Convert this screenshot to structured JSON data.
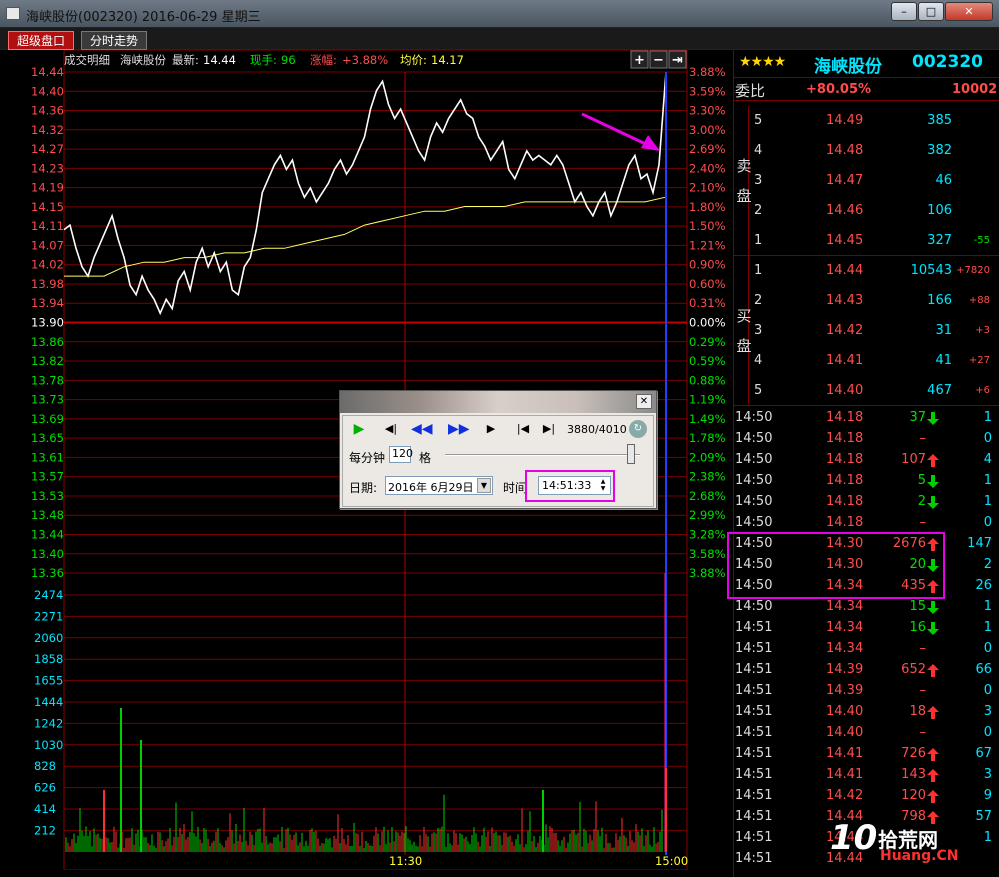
{
  "window": {
    "title": "海峡股份(002320) 2016-06-29 星期三",
    "buttons": [
      "–",
      "□",
      "✕"
    ]
  },
  "tabs": [
    {
      "label": "超级盘口",
      "active": true
    },
    {
      "label": "分时走势",
      "active": false
    }
  ],
  "chart_header": {
    "section": "成交明细",
    "name": "海峡股份",
    "latest_label": "最新:",
    "latest_value": "14.44",
    "hand_label": "现手:",
    "hand_value": "96",
    "change_label": "涨幅:",
    "change_value": "+3.88%",
    "avg_label": "均价:",
    "avg_value": "14.17",
    "tool_buttons": [
      "+",
      "−",
      "⇥"
    ]
  },
  "chart_data": {
    "type": "line",
    "title": "",
    "xlabel": "",
    "ylabel": "",
    "price_ticks": [
      "14.44",
      "14.40",
      "14.36",
      "14.32",
      "14.27",
      "14.23",
      "14.19",
      "14.15",
      "14.11",
      "14.07",
      "14.02",
      "13.98",
      "13.94",
      "13.90",
      "13.86",
      "13.82",
      "13.78",
      "13.73",
      "13.69",
      "13.65",
      "13.61",
      "13.57",
      "13.53",
      "13.48",
      "13.44",
      "13.40",
      "13.36"
    ],
    "pct_ticks": [
      "3.88%",
      "3.59%",
      "3.30%",
      "3.00%",
      "2.69%",
      "2.40%",
      "2.10%",
      "1.80%",
      "1.50%",
      "1.21%",
      "0.90%",
      "0.60%",
      "0.31%",
      "0.00%",
      "0.29%",
      "0.59%",
      "0.88%",
      "1.19%",
      "1.49%",
      "1.78%",
      "2.09%",
      "2.38%",
      "2.68%",
      "2.99%",
      "3.28%",
      "3.58%",
      "3.88%"
    ],
    "volume_ticks": [
      "2474",
      "2271",
      "2060",
      "1858",
      "1655",
      "1444",
      "1242",
      "1030",
      "828",
      "626",
      "414",
      "212"
    ],
    "x_ticks": [
      "11:30",
      "15:00"
    ],
    "prev_close": 13.9,
    "ylim": [
      13.36,
      14.44
    ],
    "series": [
      {
        "color": "#ffffff",
        "values": [
          14.1,
          14.11,
          14.06,
          14.02,
          14.0,
          14.04,
          14.07,
          14.1,
          14.13,
          14.08,
          14.04,
          13.98,
          13.96,
          14.0,
          13.97,
          13.95,
          13.92,
          13.95,
          13.93,
          13.99,
          14.01,
          13.97,
          14.03,
          14.06,
          14.02,
          14.05,
          14.01,
          14.03,
          13.97,
          13.96,
          14.02,
          14.04,
          14.1,
          14.18,
          14.21,
          14.24,
          14.26,
          14.23,
          14.25,
          14.2,
          14.17,
          14.19,
          14.16,
          14.18,
          14.2,
          14.23,
          14.25,
          14.22,
          14.24,
          14.27,
          14.3,
          14.36,
          14.4,
          14.42,
          14.37,
          14.34,
          14.36,
          14.33,
          14.3,
          14.27,
          14.25,
          14.3,
          14.33,
          14.31,
          14.34,
          14.36,
          14.38,
          14.35,
          14.34,
          14.3,
          14.28,
          14.25,
          14.27,
          14.29,
          14.23,
          14.21,
          14.24,
          14.27,
          14.25,
          14.26,
          14.25,
          14.24,
          14.26,
          14.24,
          14.2,
          14.16,
          14.18,
          14.15,
          14.13,
          14.16,
          14.18,
          14.13,
          14.16,
          14.2,
          14.24,
          14.26,
          14.21,
          14.22,
          14.18,
          14.24,
          14.44
        ]
      },
      {
        "color": "#ffff66",
        "values": [
          14.0,
          14.0,
          14.0,
          14.02,
          14.03,
          14.03,
          14.04,
          14.04,
          14.05,
          14.05,
          14.06,
          14.06,
          14.07,
          14.08,
          14.09,
          14.11,
          14.12,
          14.13,
          14.14,
          14.14,
          14.15,
          14.15,
          14.15,
          14.16,
          14.16,
          14.16,
          14.16,
          14.16,
          14.16,
          14.16,
          14.17
        ]
      }
    ]
  },
  "dialog": {
    "counter": "3880/4010",
    "speed_label": "每分钟",
    "speed_value": "120",
    "speed_unit": "格",
    "date_label": "日期:",
    "date_value": "2016年 6月29日",
    "time_label": "时间",
    "time_value": "14:51:33"
  },
  "right_panel": {
    "stars": "★★★★",
    "name": "海峡股份",
    "code": "002320",
    "weibi_label": "委比",
    "weibi_value": "+80.05%",
    "weicha_value": "10002",
    "sell_label_1": "卖",
    "sell_label_2": "盘",
    "buy_label_1": "买",
    "buy_label_2": "盘",
    "sell": [
      {
        "level": "5",
        "price": "14.49",
        "vol": "385",
        "chg": ""
      },
      {
        "level": "4",
        "price": "14.48",
        "vol": "382",
        "chg": ""
      },
      {
        "level": "3",
        "price": "14.47",
        "vol": "46",
        "chg": ""
      },
      {
        "level": "2",
        "price": "14.46",
        "vol": "106",
        "chg": ""
      },
      {
        "level": "1",
        "price": "14.45",
        "vol": "327",
        "chg": "-55"
      }
    ],
    "buy": [
      {
        "level": "1",
        "price": "14.44",
        "vol": "10543",
        "chg": "+7820"
      },
      {
        "level": "2",
        "price": "14.43",
        "vol": "166",
        "chg": "+88"
      },
      {
        "level": "3",
        "price": "14.42",
        "vol": "31",
        "chg": "+3"
      },
      {
        "level": "4",
        "price": "14.41",
        "vol": "41",
        "chg": "+27"
      },
      {
        "level": "5",
        "price": "14.40",
        "vol": "467",
        "chg": "+6"
      }
    ],
    "trades": [
      {
        "time": "14:50",
        "price": "14.18",
        "vol": "37",
        "dir": "down",
        "cnt": "1"
      },
      {
        "time": "14:50",
        "price": "14.18",
        "vol": "–",
        "dir": "none",
        "cnt": "0"
      },
      {
        "time": "14:50",
        "price": "14.18",
        "vol": "107",
        "dir": "up",
        "cnt": "4"
      },
      {
        "time": "14:50",
        "price": "14.18",
        "vol": "5",
        "dir": "down",
        "cnt": "1"
      },
      {
        "time": "14:50",
        "price": "14.18",
        "vol": "2",
        "dir": "down",
        "cnt": "1"
      },
      {
        "time": "14:50",
        "price": "14.18",
        "vol": "–",
        "dir": "none",
        "cnt": "0"
      },
      {
        "time": "14:50",
        "price": "14.30",
        "vol": "2676",
        "dir": "up",
        "cnt": "147"
      },
      {
        "time": "14:50",
        "price": "14.30",
        "vol": "20",
        "dir": "down",
        "cnt": "2"
      },
      {
        "time": "14:50",
        "price": "14.34",
        "vol": "435",
        "dir": "up",
        "cnt": "26"
      },
      {
        "time": "14:50",
        "price": "14.34",
        "vol": "15",
        "dir": "down",
        "cnt": "1"
      },
      {
        "time": "14:51",
        "price": "14.34",
        "vol": "16",
        "dir": "down",
        "cnt": "1"
      },
      {
        "time": "14:51",
        "price": "14.34",
        "vol": "–",
        "dir": "none",
        "cnt": "0"
      },
      {
        "time": "14:51",
        "price": "14.39",
        "vol": "652",
        "dir": "up",
        "cnt": "66"
      },
      {
        "time": "14:51",
        "price": "14.39",
        "vol": "–",
        "dir": "none",
        "cnt": "0"
      },
      {
        "time": "14:51",
        "price": "14.40",
        "vol": "18",
        "dir": "up",
        "cnt": "3"
      },
      {
        "time": "14:51",
        "price": "14.40",
        "vol": "–",
        "dir": "none",
        "cnt": "0"
      },
      {
        "time": "14:51",
        "price": "14.41",
        "vol": "726",
        "dir": "up",
        "cnt": "67"
      },
      {
        "time": "14:51",
        "price": "14.41",
        "vol": "143",
        "dir": "up",
        "cnt": "3"
      },
      {
        "time": "14:51",
        "price": "14.42",
        "vol": "120",
        "dir": "up",
        "cnt": "9"
      },
      {
        "time": "14:51",
        "price": "14.44",
        "vol": "798",
        "dir": "up",
        "cnt": "57"
      },
      {
        "time": "14:51",
        "price": "14.44",
        "vol": "",
        "dir": "none",
        "cnt": "1"
      },
      {
        "time": "14:51",
        "price": "14.44",
        "vol": "",
        "dir": "none",
        "cnt": ""
      }
    ]
  },
  "watermark": {
    "main": "拾荒网",
    "sub": "Huang.CN",
    "num": "10"
  },
  "colors": {
    "up": "#ff4d4d",
    "down": "#00e000",
    "cyan": "#00e5ff",
    "grid": "#8b0000",
    "highlight": "#e600e6"
  }
}
